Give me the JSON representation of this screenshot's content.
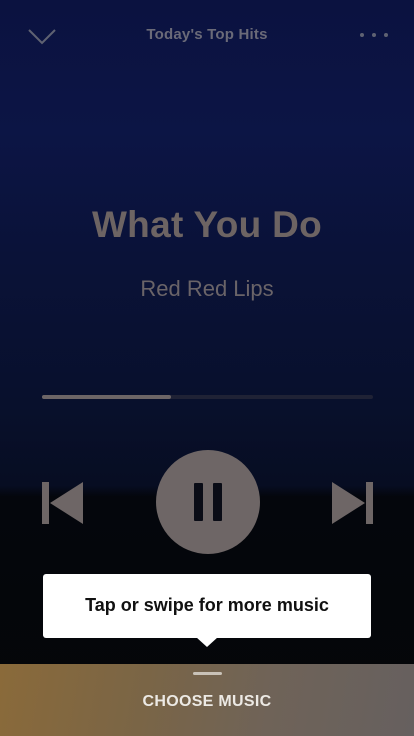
{
  "header": {
    "playlist_title": "Today's Top Hits",
    "collapse_icon": "chevron-down-icon",
    "more_icon": "more-horizontal-icon"
  },
  "track": {
    "title": "What You Do",
    "artist": "Red Red Lips"
  },
  "playback": {
    "progress_fraction": 0.39,
    "state": "playing",
    "prev_icon": "skip-previous-icon",
    "pause_icon": "pause-icon",
    "next_icon": "skip-next-icon"
  },
  "tooltip": {
    "text": "Tap or swipe for more music"
  },
  "bottom_sheet": {
    "label": "CHOOSE MUSIC",
    "handle_icon": "drag-handle-icon"
  },
  "colors": {
    "background_top": "#0b1240",
    "control_gray": "#6e6666",
    "tooltip_bg": "#ffffff",
    "bottom_bar_start": "#8a6a3a",
    "bottom_bar_end": "#66605f"
  }
}
